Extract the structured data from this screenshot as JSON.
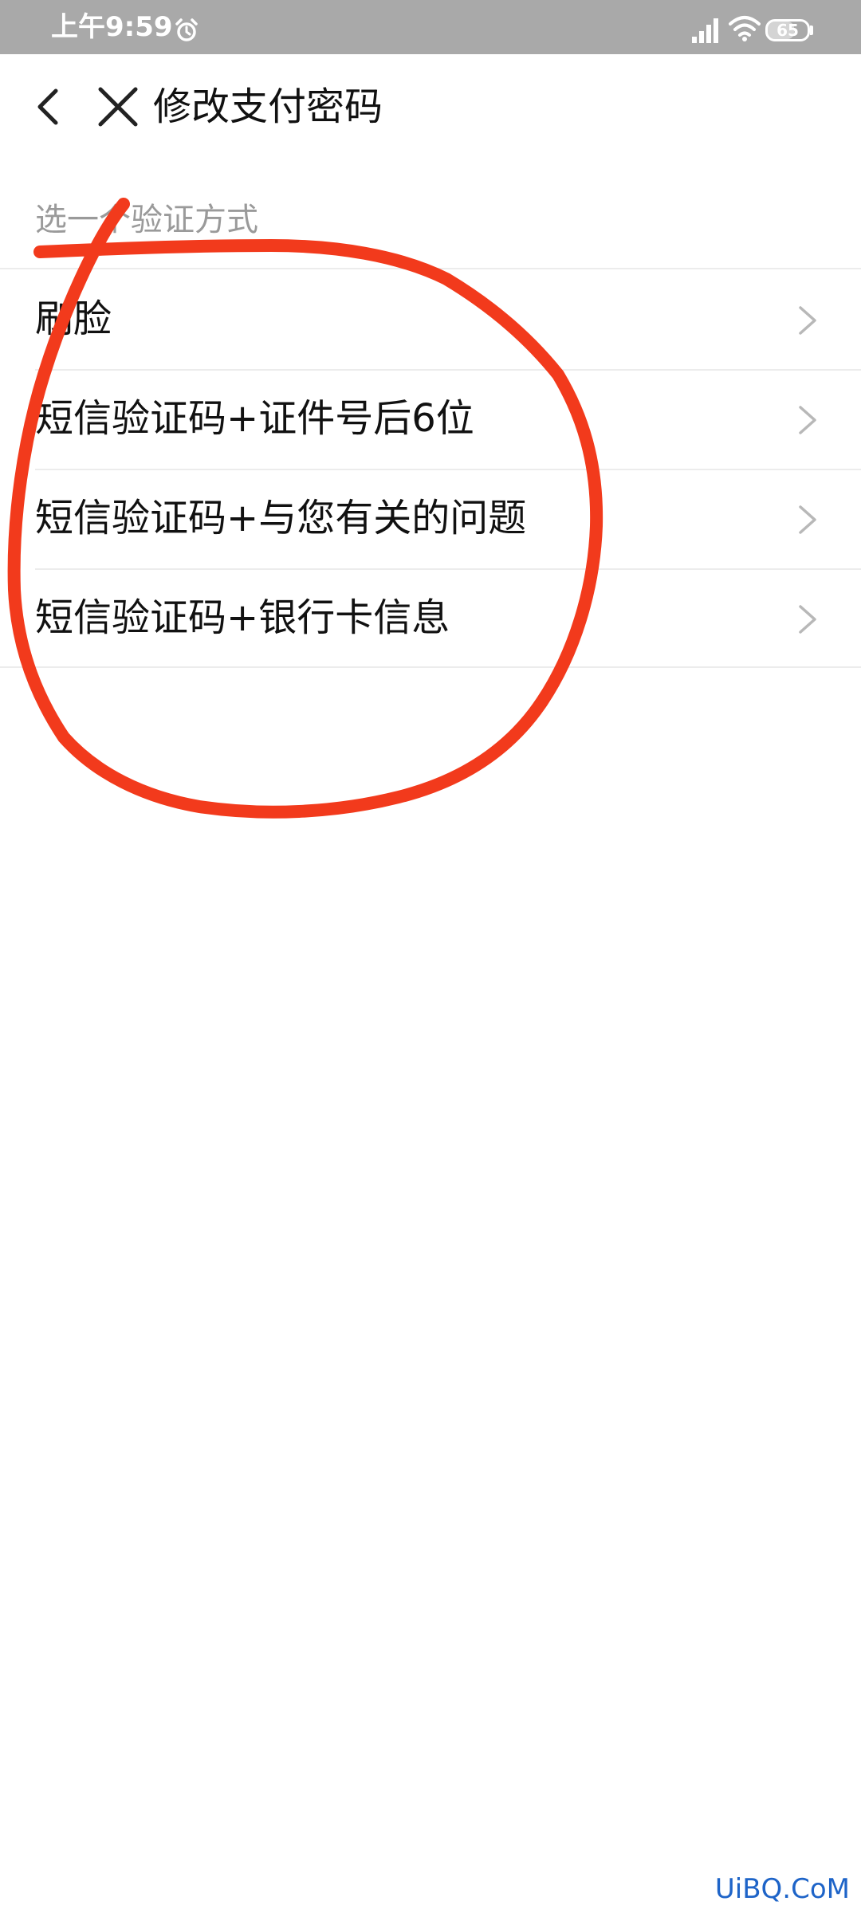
{
  "status_bar": {
    "time": "上午9:59",
    "battery": "65",
    "battery_level": 0.65,
    "icons": [
      "alarm-icon",
      "signal-icon",
      "wifi-icon",
      "battery-icon"
    ]
  },
  "header": {
    "title": "修改支付密码",
    "icons": [
      "back-arrow-icon",
      "close-icon"
    ]
  },
  "section_hint": "选一个验证方式",
  "options": [
    {
      "label": "刷脸"
    },
    {
      "label": "短信验证码+证件号后6位"
    },
    {
      "label": "短信验证码+与您有关的问题"
    },
    {
      "label": "短信验证码+银行卡信息"
    }
  ],
  "colors": {
    "status_bar": "#a9a9a9",
    "annotation": "#f23a1c",
    "hint_text": "#9a9a9a",
    "watermark": "#1e64c8"
  },
  "watermark": "UiBQ.CoM"
}
